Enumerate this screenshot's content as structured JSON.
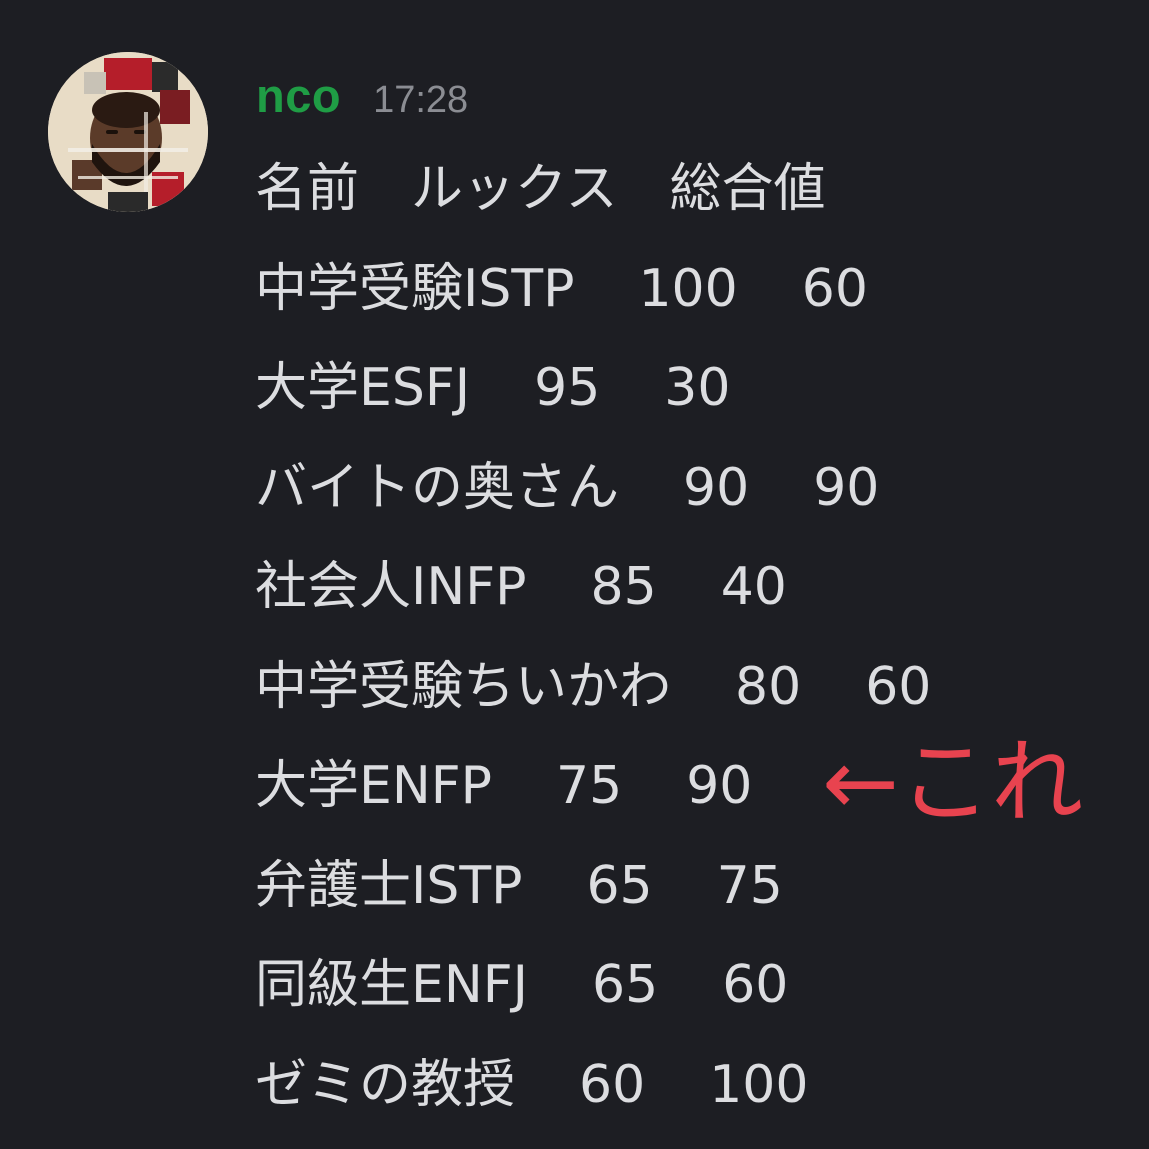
{
  "message": {
    "username": "nco",
    "timestamp": "17:28",
    "header_line": "名前　ルックス　総合値",
    "rows": [
      {
        "name": "中学受験ISTP",
        "looks": "100",
        "total": "60"
      },
      {
        "name": "大学ESFJ",
        "looks": "95",
        "total": "30"
      },
      {
        "name": "バイトの奥さん",
        "looks": "90",
        "total": "90"
      },
      {
        "name": "社会人INFP",
        "looks": "85",
        "total": "40"
      },
      {
        "name": "中学受験ちいかわ",
        "looks": "80",
        "total": "60"
      },
      {
        "name": "大学ENFP",
        "looks": "75",
        "total": "90"
      },
      {
        "name": "弁護士ISTP",
        "looks": "65",
        "total": "75"
      },
      {
        "name": "同級生ENFJ",
        "looks": "65",
        "total": "60"
      },
      {
        "name": "ゼミの教授",
        "looks": "60",
        "total": "100"
      }
    ]
  },
  "annotation": {
    "text": "←これ",
    "color": "#e8434f"
  },
  "colors": {
    "background": "#1d1e23",
    "username": "#1f9d45",
    "timestamp": "#8b8d93",
    "text": "#dcdde0"
  }
}
